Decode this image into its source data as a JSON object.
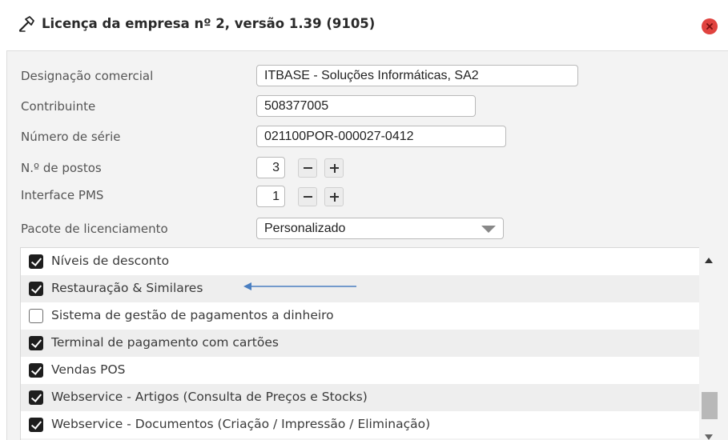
{
  "window": {
    "title": "Licença da empresa nº 2, versão 1.39 (9105)",
    "title_icon": "hammer-icon",
    "close_icon": "close-icon",
    "close_color": "#e0433f"
  },
  "form": {
    "designacao_label": "Designação comercial",
    "designacao_value": "ITBASE - Soluções Informáticas, SA2",
    "contribuinte_label": "Contribuinte",
    "contribuinte_value": "508377005",
    "serie_label": "Número de série",
    "serie_value": "021100POR-000027-0412",
    "postos_label": "N.º de postos",
    "postos_value": "3",
    "pms_label": "Interface PMS",
    "pms_value": "1",
    "pacote_label": "Pacote de licenciamento",
    "pacote_value": "Personalizado"
  },
  "modules": [
    {
      "label": "Níveis de desconto",
      "checked": true
    },
    {
      "label": "Restauração & Similares",
      "checked": true
    },
    {
      "label": "Sistema de gestão de pagamentos a dinheiro",
      "checked": false
    },
    {
      "label": "Terminal de pagamento com cartões",
      "checked": true
    },
    {
      "label": "Vendas POS",
      "checked": true
    },
    {
      "label": "Webservice - Artigos (Consulta de Preços e Stocks)",
      "checked": true
    },
    {
      "label": "Webservice - Documentos (Criação / Impressão / Eliminação)",
      "checked": true
    }
  ],
  "annotation": {
    "arrow_color": "#4a7fc1",
    "target": "Restauração & Similares"
  }
}
